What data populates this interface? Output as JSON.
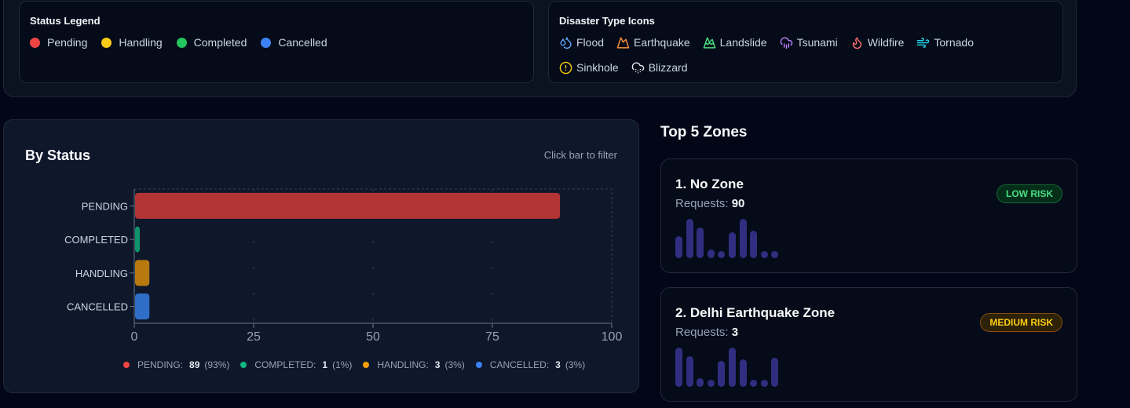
{
  "status_legend": {
    "title": "Status Legend",
    "items": [
      {
        "label": "Pending",
        "color": "#ef4444"
      },
      {
        "label": "Handling",
        "color": "#facc15"
      },
      {
        "label": "Completed",
        "color": "#22c55e"
      },
      {
        "label": "Cancelled",
        "color": "#3b82f6"
      }
    ]
  },
  "disaster_legend": {
    "title": "Disaster Type Icons",
    "items": [
      {
        "label": "Flood",
        "icon": "droplets-icon",
        "color": "#60a5fa"
      },
      {
        "label": "Earthquake",
        "icon": "mountain-icon",
        "color": "#fb923c"
      },
      {
        "label": "Landslide",
        "icon": "mountain-snow-icon",
        "color": "#4ade80"
      },
      {
        "label": "Tsunami",
        "icon": "cloud-rain-icon",
        "color": "#c084fc"
      },
      {
        "label": "Wildfire",
        "icon": "flame-icon",
        "color": "#f87171"
      },
      {
        "label": "Tornado",
        "icon": "wind-icon",
        "color": "#22d3ee"
      },
      {
        "label": "Sinkhole",
        "icon": "alert-circle-icon",
        "color": "#facc15"
      },
      {
        "label": "Blizzard",
        "icon": "cloud-snow-icon",
        "color": "#e2e8f0"
      }
    ]
  },
  "status_chart": {
    "title": "By Status",
    "hint": "Click bar to filter"
  },
  "chart_data": {
    "type": "bar",
    "orientation": "horizontal",
    "categories": [
      "PENDING",
      "COMPLETED",
      "HANDLING",
      "CANCELLED"
    ],
    "values": [
      89,
      1,
      3,
      3
    ],
    "colors": [
      "#b33434",
      "#10936b",
      "#b8790f",
      "#2f6ec7"
    ],
    "xlim": [
      0,
      100
    ],
    "xticks": [
      0,
      25,
      50,
      75,
      100
    ],
    "grid": true,
    "legend": [
      {
        "label": "PENDING:",
        "count": "89",
        "pct": "(93%)",
        "color": "#ef4444"
      },
      {
        "label": "COMPLETED:",
        "count": "1",
        "pct": "(1%)",
        "color": "#10b981"
      },
      {
        "label": "HANDLING:",
        "count": "3",
        "pct": "(3%)",
        "color": "#f59e0b"
      },
      {
        "label": "CANCELLED:",
        "count": "3",
        "pct": "(3%)",
        "color": "#3b82f6"
      }
    ]
  },
  "zones": {
    "title": "Top 5 Zones",
    "items": [
      {
        "name": "1. No Zone",
        "requests_label": "Requests:",
        "requests": "90",
        "risk": "LOW RISK",
        "spark": [
          0.55,
          1.0,
          0.78,
          0.22,
          0.14,
          0.66,
          1.0,
          0.7,
          0.18,
          0.18
        ]
      },
      {
        "name": "2. Delhi Earthquake Zone",
        "requests_label": "Requests:",
        "requests": "3",
        "risk": "MEDIUM RISK",
        "spark": [
          1.0,
          0.78,
          0.22,
          0.14,
          0.66,
          1.0,
          0.7,
          0.18,
          0.18,
          0.74
        ]
      }
    ]
  }
}
